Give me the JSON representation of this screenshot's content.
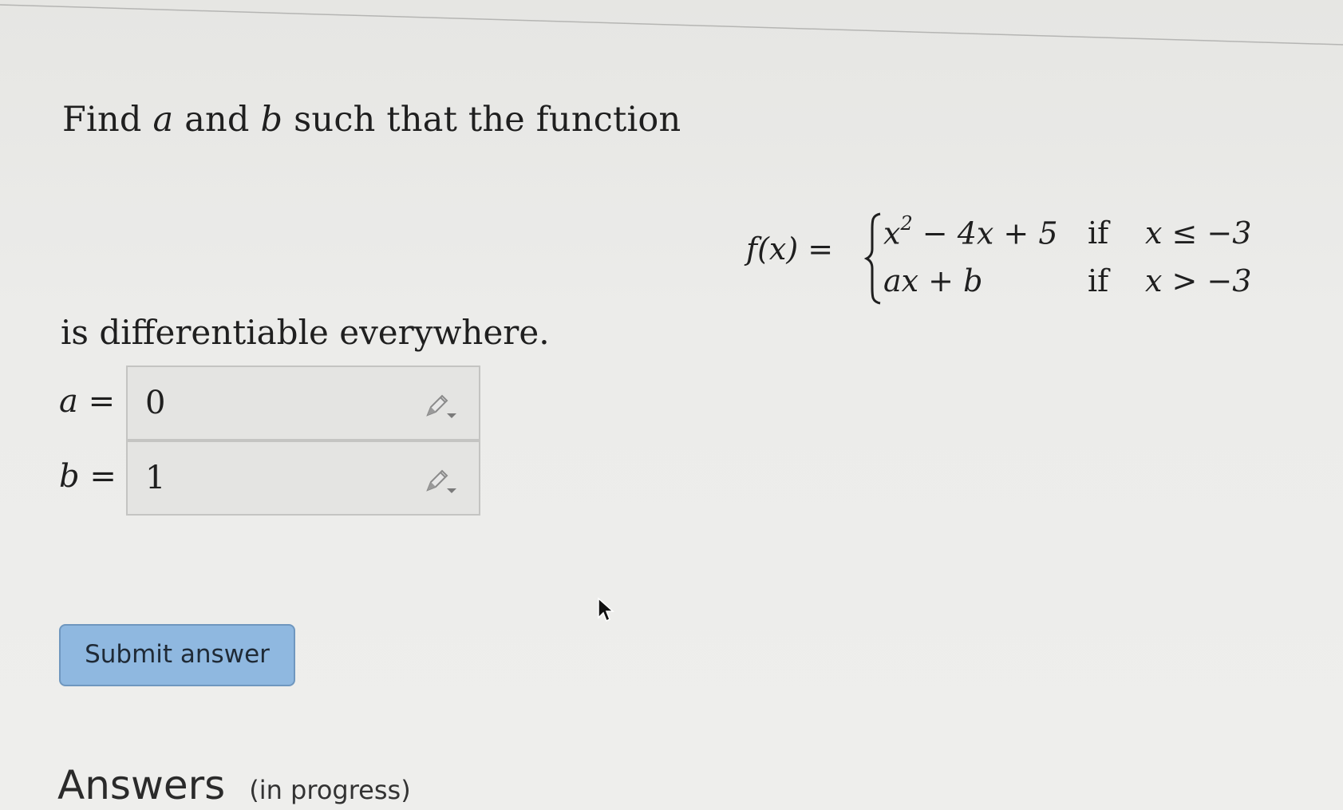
{
  "problem": {
    "intro_word1": "Find",
    "var_a": "a",
    "intro_and": "and",
    "var_b": "b",
    "intro_rest": "such that the function",
    "conclusion": "is differentiable everywhere."
  },
  "formula": {
    "lhs": "f(x) =",
    "case1_expr_base": "x",
    "case1_expr_exp": "2",
    "case1_expr_rest": " − 4x + 5",
    "case1_if": "if",
    "case1_cond": "x ≤ −3",
    "case2_expr": "ax + b",
    "case2_if": "if",
    "case2_cond": "x > −3"
  },
  "answers_form": {
    "a_label": "a =",
    "a_value": "0",
    "b_label": "b =",
    "b_value": "1"
  },
  "submit": {
    "label": "Submit answer"
  },
  "answers_section": {
    "heading": "Answers",
    "status": "(in progress)"
  },
  "icons": {
    "edit": "pencil-dropdown-icon",
    "cursor": "mouse-pointer-icon"
  },
  "colors": {
    "button_bg": "#8fb8e0",
    "input_bg": "#e4e4e2"
  }
}
